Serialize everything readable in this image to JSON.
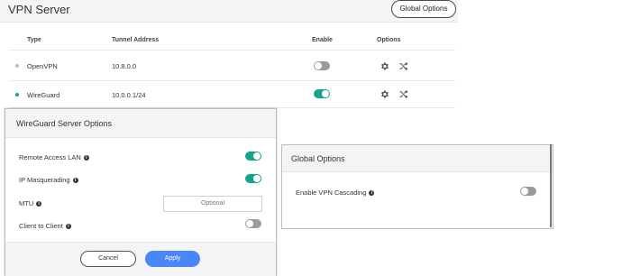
{
  "vpn": {
    "title": "VPN Server",
    "global_options_label": "Global Options",
    "columns": [
      "Type",
      "Tunnel Address",
      "Enable",
      "Options"
    ],
    "rows": [
      {
        "type": "OpenVPN",
        "address": "10.8.0.0",
        "enabled": false,
        "status_color": "#bdbdbd"
      },
      {
        "type": "WireGuard",
        "address": "10.0.0.1/24",
        "enabled": true,
        "status_color": "#13a58b"
      }
    ],
    "icons": [
      "gear-icon",
      "shuffle-icon"
    ]
  },
  "wireguard_dialog": {
    "title": "WireGuard Server Options",
    "options": [
      {
        "label": "Remote Access LAN",
        "enabled": true
      },
      {
        "label": "IP Masquerading",
        "enabled": true
      },
      {
        "label": "MTU"
      },
      {
        "label": "Client to Client",
        "enabled": false
      }
    ],
    "mtu_placeholder": "Optional",
    "cancel_label": "Cancel",
    "apply_label": "Apply",
    "apply_color": "#4a86f7"
  },
  "global_dialog": {
    "title": "Global Options",
    "option_label": "Enable VPN Cascading",
    "enabled": false
  },
  "colors": {
    "accent": "#13a58b",
    "toggle_off": "#9a9a9a"
  }
}
